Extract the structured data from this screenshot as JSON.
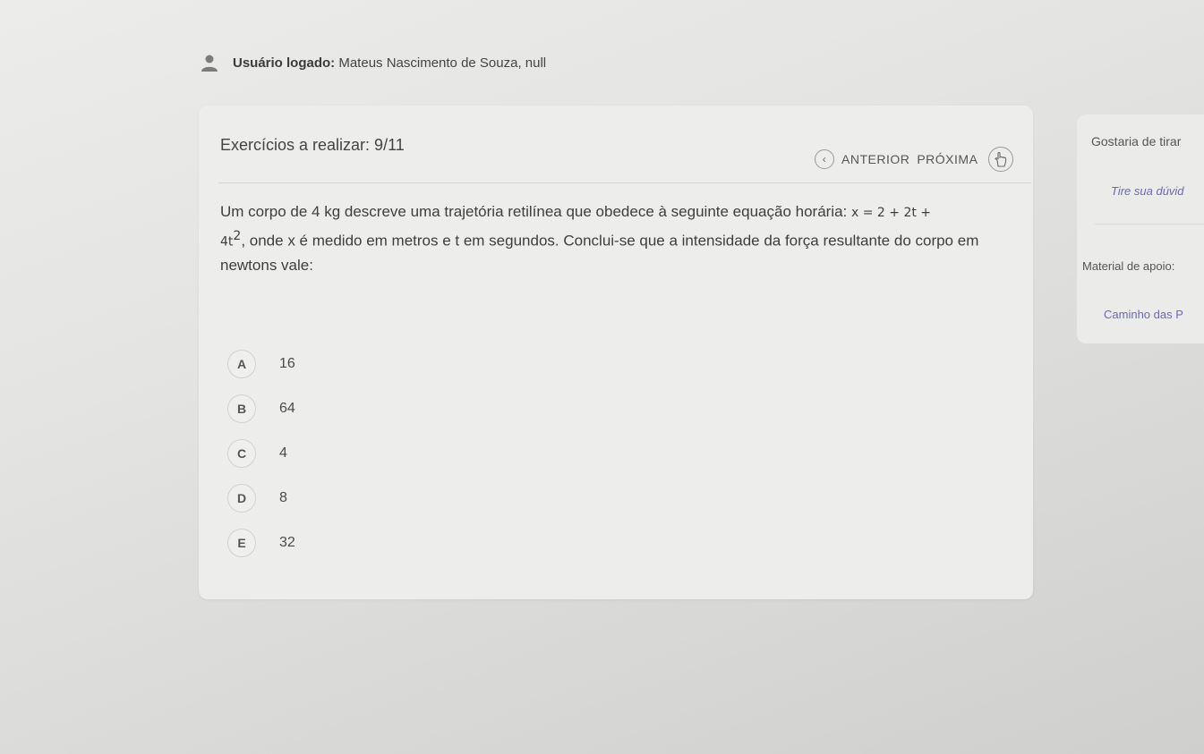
{
  "user": {
    "label": "Usuário logado:",
    "name": "Mateus Nascimento de Souza, null"
  },
  "header": {
    "exercises_label": "Exercícios a realizar: 9/11"
  },
  "nav": {
    "previous_label": "ANTERIOR",
    "next_label": "PRÓXIMA"
  },
  "question": {
    "text_part1": "Um corpo de 4 kg descreve uma trajetória retilínea que obedece à seguinte equação horária:",
    "equation_part1": "x = 2 + 2t +",
    "equation_part2": "4t",
    "exponent": "2",
    "text_part2": ", onde x é medido em metros e t em segundos. Conclui-se que a intensidade da força resultante do corpo em newtons vale:"
  },
  "options": [
    {
      "letter": "A",
      "value": "16"
    },
    {
      "letter": "B",
      "value": "64"
    },
    {
      "letter": "C",
      "value": "4"
    },
    {
      "letter": "D",
      "value": "8"
    },
    {
      "letter": "E",
      "value": "32"
    }
  ],
  "side": {
    "doubt_title": "Gostaria de tirar",
    "doubt_link": "Tire sua dúvid",
    "material_title": "Material de apoio:",
    "material_link": "Caminho das P"
  },
  "colors": {
    "link": "#6b68b8",
    "card": "#ededeb",
    "background": "#e2e2e0"
  },
  "icons": {
    "avatar": "user-avatar-icon",
    "previous": "chevron-left-icon",
    "cursor": "hand-pointer-icon"
  }
}
